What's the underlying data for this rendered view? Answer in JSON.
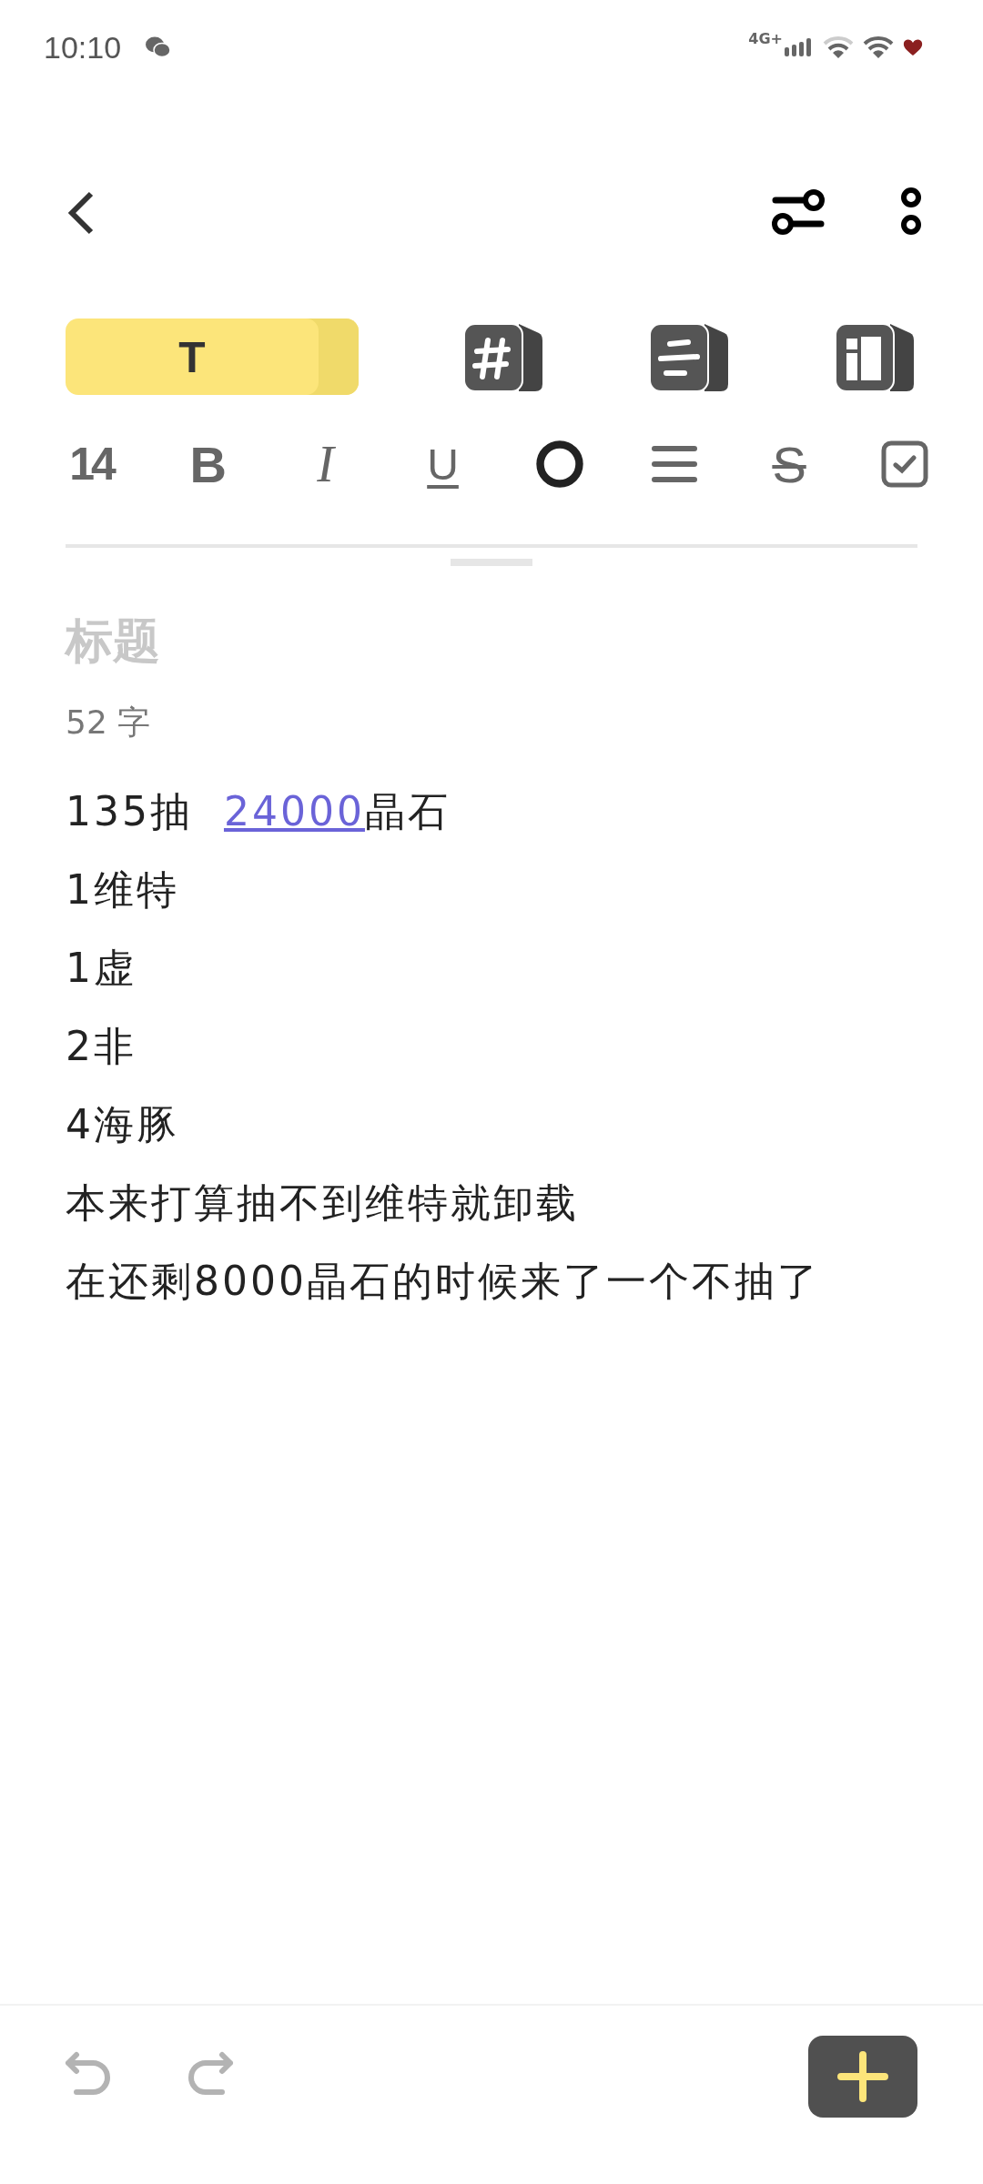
{
  "status_bar": {
    "time": "10:10",
    "network": "4G+"
  },
  "mode_tabs": [
    {
      "kind": "text",
      "label": "T",
      "selected": true
    },
    {
      "kind": "tag",
      "selected": false
    },
    {
      "kind": "list",
      "selected": false
    },
    {
      "kind": "layout",
      "selected": false
    }
  ],
  "format_tools": [
    {
      "kind": "size",
      "label": "14"
    },
    {
      "kind": "bold",
      "label": "B"
    },
    {
      "kind": "italic",
      "label": "I"
    },
    {
      "kind": "underline",
      "label": "U"
    },
    {
      "kind": "color"
    },
    {
      "kind": "align"
    },
    {
      "kind": "strike",
      "label": "S"
    },
    {
      "kind": "checkbox"
    }
  ],
  "title": {
    "placeholder": "标题"
  },
  "word_count": "52 字",
  "body": [
    [
      {
        "text": "135抽  "
      },
      {
        "text": "24000",
        "link": true
      },
      {
        "text": "晶石"
      }
    ],
    [
      {
        "text": "1维特"
      }
    ],
    [
      {
        "text": "1虚"
      }
    ],
    [
      {
        "text": "2非"
      }
    ],
    [
      {
        "text": "4海豚"
      }
    ],
    [
      {
        "text": "本来打算抽不到维特就卸载"
      }
    ],
    [
      {
        "text": "在还剩8000晶石的时候来了一个不抽了"
      }
    ]
  ]
}
